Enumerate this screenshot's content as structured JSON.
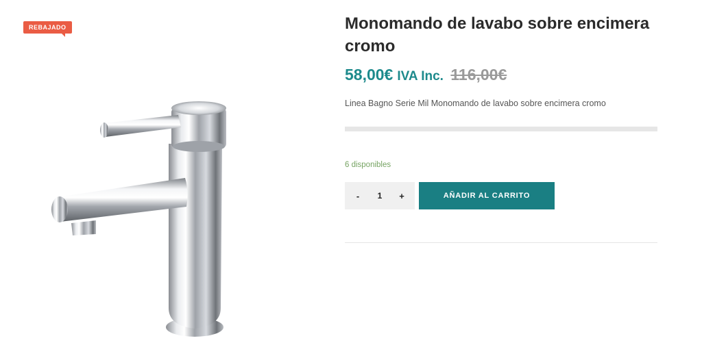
{
  "badge": {
    "sale_label": "REBAJADO"
  },
  "product": {
    "title": "Monomando de lavabo sobre encimera cromo",
    "price_current": "58,00€",
    "price_suffix": "IVA Inc.",
    "price_regular": "116,00€",
    "short_description": "Linea Bagno Serie Mil Monomando de lavabo sobre encimera cromo",
    "stock": "6 disponibles",
    "image_icon": "chrome-basin-faucet-image"
  },
  "cart": {
    "minus_label": "-",
    "plus_label": "+",
    "quantity": "1",
    "add_to_cart_label": "AÑADIR AL CARRITO"
  },
  "colors": {
    "accent": "#1a7f83",
    "price": "#1d8a8c",
    "sale_badge": "#ea5c44",
    "stock": "#77a464"
  }
}
